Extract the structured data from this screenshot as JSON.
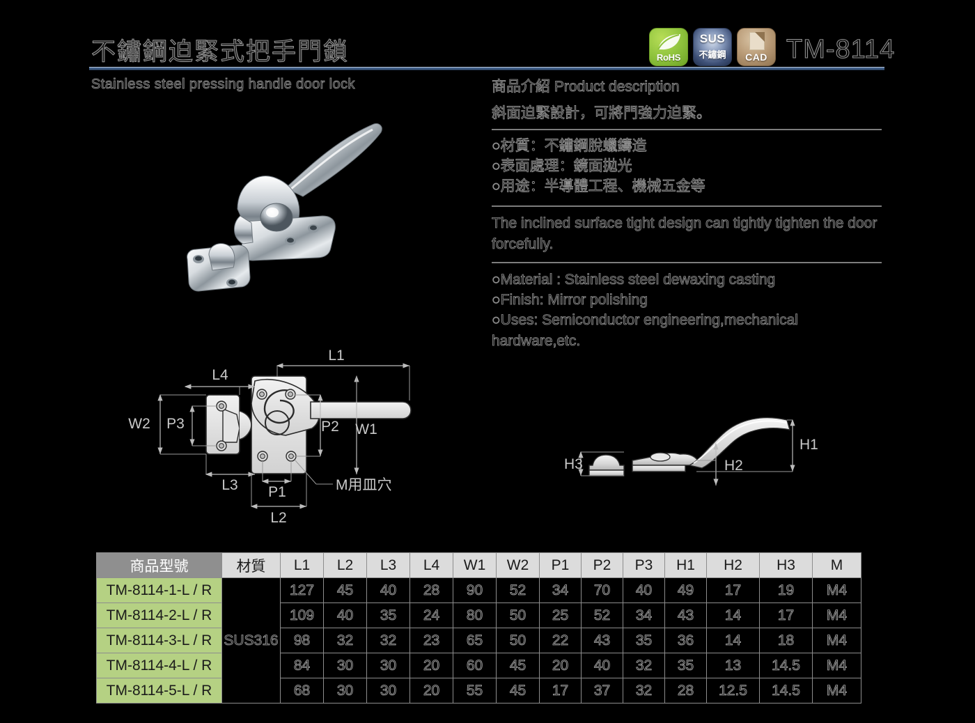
{
  "header": {
    "title_zh": "不鏽鋼迫緊式把手門鎖",
    "title_en": "Stainless steel pressing handle door lock",
    "model_no": "TM-8114",
    "badges": [
      {
        "id": "rohs-badge",
        "label": "RoHS"
      },
      {
        "id": "sus-badge",
        "line1": "SUS",
        "line2": "不鏽鋼"
      },
      {
        "id": "cad-badge",
        "label": "CAD"
      }
    ]
  },
  "description": {
    "heading": "商品介紹 Product description",
    "lead_zh": "斜面迫緊設計，可將門強力迫緊。",
    "bullets_zh": [
      "○材質：不鏽鋼脫蠟鑄造",
      "○表面處理：鏡面拋光",
      "○用途：半導體工程、機械五金等"
    ],
    "lead_en": "The inclined surface tight design can tightly tighten the door forcefully.",
    "bullets_en": [
      "○Material : Stainless steel dewaxing casting",
      "○Finish: Mirror polishing",
      "○Uses: Semiconductor engineering,mechanical hardware,etc."
    ]
  },
  "drawings": {
    "top_view": {
      "name": "top-view-drawing",
      "labels": [
        "L1",
        "L2",
        "L3",
        "L4",
        "W1",
        "W2",
        "P1",
        "P2",
        "P3"
      ],
      "callout": "M用皿穴"
    },
    "side_view": {
      "name": "side-view-drawing",
      "labels": [
        "H1",
        "H2",
        "H3"
      ]
    }
  },
  "chart_data": {
    "type": "table",
    "title": "TM-8114 dimension specification",
    "columns": [
      "商品型號",
      "材質",
      "L1",
      "L2",
      "L3",
      "L4",
      "W1",
      "W2",
      "P1",
      "P2",
      "P3",
      "H1",
      "H2",
      "H3",
      "M"
    ],
    "material_merged": "SUS316",
    "rows": [
      {
        "model": "TM-8114-1-L / R",
        "material": "SUS316",
        "values": [
          "127",
          "45",
          "40",
          "28",
          "90",
          "52",
          "34",
          "70",
          "40",
          "49",
          "17",
          "19",
          "M4"
        ]
      },
      {
        "model": "TM-8114-2-L / R",
        "material": "SUS316",
        "values": [
          "109",
          "40",
          "35",
          "24",
          "80",
          "50",
          "25",
          "52",
          "34",
          "43",
          "14",
          "17",
          "M4"
        ]
      },
      {
        "model": "TM-8114-3-L / R",
        "material": "SUS316",
        "values": [
          "98",
          "32",
          "32",
          "23",
          "65",
          "50",
          "22",
          "43",
          "35",
          "36",
          "14",
          "18",
          "M4"
        ]
      },
      {
        "model": "TM-8114-4-L / R",
        "material": "SUS316",
        "values": [
          "84",
          "30",
          "30",
          "20",
          "60",
          "45",
          "20",
          "40",
          "32",
          "35",
          "13",
          "14.5",
          "M4"
        ]
      },
      {
        "model": "TM-8114-5-L / R",
        "material": "SUS316",
        "values": [
          "68",
          "30",
          "30",
          "20",
          "55",
          "45",
          "17",
          "37",
          "32",
          "28",
          "12.5",
          "14.5",
          "M4"
        ]
      }
    ]
  },
  "colors": {
    "background": "#000000",
    "rule_blue": "#3f5d86",
    "model_cell_green": "#b5d183",
    "header_gray": "#8f8f8f",
    "header_cell_gray": "#dcdcdc"
  }
}
